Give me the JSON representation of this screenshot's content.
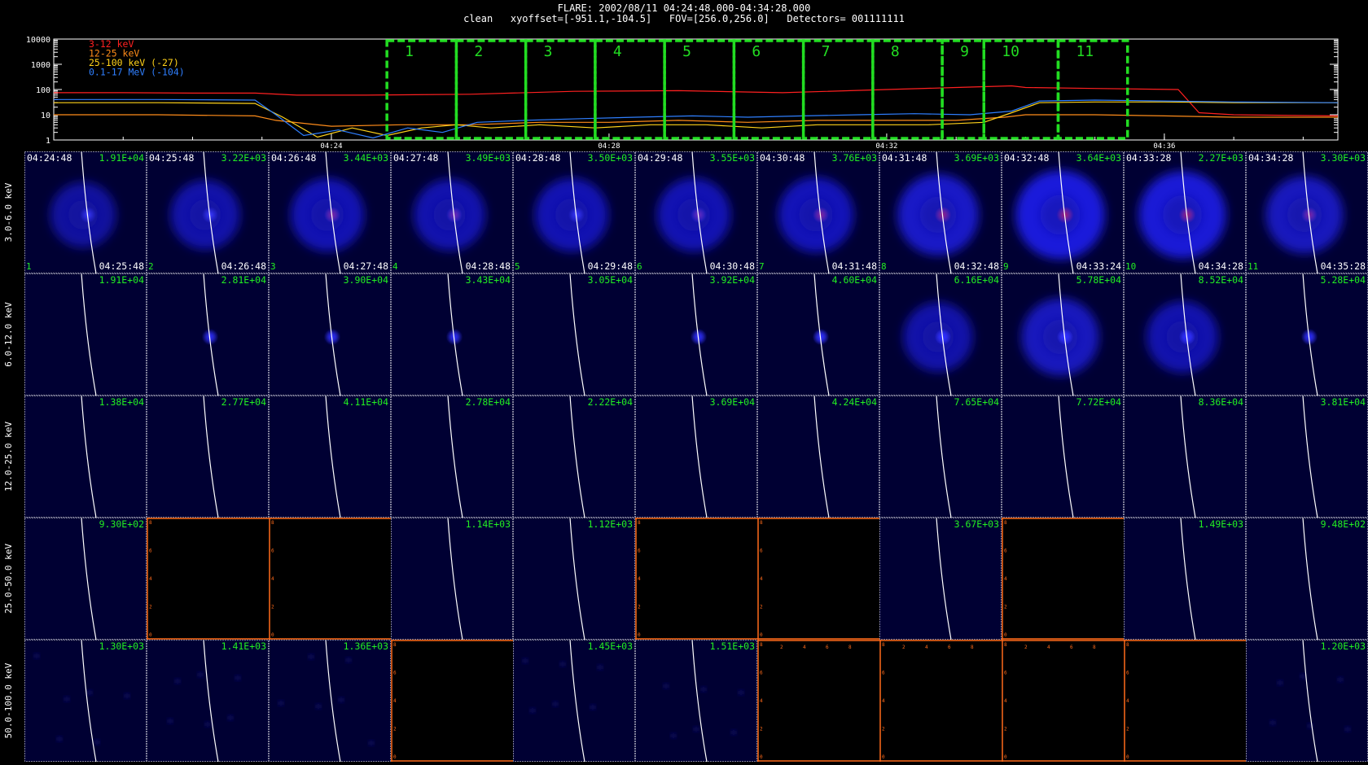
{
  "header": {
    "line1": "FLARE: 2002/08/11 04:24:48.000-04:34:28.000",
    "line2": "clean   xyoffset=[-951.1,-104.5]   FOV=[256.0,256.0]   Detectors= 001111111"
  },
  "lightcurve": {
    "type": "line",
    "y_scale": "log",
    "ylim": [
      1,
      10000
    ],
    "y_ticks": [
      "10000",
      "1000",
      "100",
      "10",
      "1"
    ],
    "x_ticks": [
      {
        "t": 24.0,
        "label": "04:24"
      },
      {
        "t": 28.0,
        "label": "04:28"
      },
      {
        "t": 32.0,
        "label": "04:32"
      },
      {
        "t": 36.0,
        "label": "04:36"
      }
    ],
    "xlim": [
      20.0,
      38.5
    ],
    "legend": [
      {
        "label": "3-12 keV",
        "color": "#ff2020"
      },
      {
        "label": "12-25 keV",
        "color": "#ff8c1a"
      },
      {
        "label": "25-100 keV (-27)",
        "color": "#ffd21a"
      },
      {
        "label": "0.1-17 MeV (-104)",
        "color": "#2f7fff"
      }
    ],
    "series": [
      {
        "name": "3-12 keV",
        "color": "#ff2020",
        "x": [
          20.0,
          21.0,
          22.0,
          22.9,
          23.5,
          24.5,
          26.0,
          27.5,
          29.0,
          30.5,
          32.0,
          33.0,
          33.8,
          34.0,
          35.0,
          36.2,
          36.5,
          37.0,
          38.5
        ],
        "values": [
          75,
          75,
          72,
          72,
          60,
          60,
          65,
          85,
          90,
          75,
          100,
          120,
          140,
          120,
          110,
          100,
          12,
          10,
          9
        ]
      },
      {
        "name": "12-25 keV",
        "color": "#ff8c1a",
        "x": [
          20.0,
          21.5,
          22.9,
          23.2,
          24.0,
          25.0,
          26.0,
          27.0,
          28.0,
          29.0,
          30.0,
          31.0,
          32.0,
          33.0,
          33.7,
          34.0,
          35.0,
          36.0,
          37.0,
          38.5
        ],
        "values": [
          10,
          10,
          9,
          6,
          3.5,
          4,
          4,
          5,
          5,
          6,
          5,
          6,
          6,
          6,
          8,
          10,
          10,
          9,
          8,
          8
        ]
      },
      {
        "name": "25-100 keV (-27)",
        "color": "#ffd21a",
        "x": [
          20.0,
          21.5,
          22.9,
          23.3,
          23.8,
          24.3,
          24.8,
          25.3,
          25.8,
          26.3,
          27.0,
          27.8,
          28.6,
          29.4,
          30.2,
          31.0,
          31.8,
          32.6,
          33.4,
          33.8,
          34.2,
          35.0,
          36.0,
          37.0,
          38.5
        ],
        "values": [
          30,
          30,
          28,
          8,
          1.3,
          3,
          1.5,
          3,
          4,
          3,
          4,
          3,
          4,
          4,
          3,
          4,
          4,
          4,
          5,
          12,
          30,
          32,
          32,
          30,
          30
        ]
      },
      {
        "name": "0.1-17 MeV (-104)",
        "color": "#2f7fff",
        "x": [
          20.0,
          21.5,
          22.9,
          23.2,
          23.6,
          24.1,
          24.6,
          25.1,
          25.6,
          26.1,
          26.8,
          27.6,
          28.4,
          29.2,
          30.0,
          30.8,
          31.6,
          32.4,
          33.2,
          33.8,
          34.2,
          35.0,
          36.0,
          37.0,
          38.5
        ],
        "values": [
          40,
          40,
          38,
          10,
          1.5,
          2.5,
          1.2,
          3,
          2,
          5,
          6,
          7,
          8,
          9,
          8,
          9,
          10,
          11,
          10,
          14,
          35,
          38,
          35,
          32,
          30
        ]
      }
    ],
    "intervals": [
      {
        "label": "1",
        "start": 24.8,
        "end": 25.8
      },
      {
        "label": "2",
        "start": 25.8,
        "end": 26.8
      },
      {
        "label": "3",
        "start": 26.8,
        "end": 27.8
      },
      {
        "label": "4",
        "start": 27.8,
        "end": 28.8
      },
      {
        "label": "5",
        "start": 28.8,
        "end": 29.8
      },
      {
        "label": "6",
        "start": 29.8,
        "end": 30.8
      },
      {
        "label": "7",
        "start": 30.8,
        "end": 31.8
      },
      {
        "label": "8",
        "start": 31.8,
        "end": 32.8
      },
      {
        "label": "9",
        "start": 32.8,
        "end": 33.4
      },
      {
        "label": "10",
        "start": 33.4,
        "end": 34.47
      },
      {
        "label": "11",
        "start": 34.47,
        "end": 35.47
      }
    ]
  },
  "image_grid": {
    "columns": [
      {
        "num": "1",
        "start": "04:24:48",
        "end": "04:25:48"
      },
      {
        "num": "2",
        "start": "04:25:48",
        "end": "04:26:48"
      },
      {
        "num": "3",
        "start": "04:26:48",
        "end": "04:27:48"
      },
      {
        "num": "4",
        "start": "04:27:48",
        "end": "04:28:48"
      },
      {
        "num": "5",
        "start": "04:28:48",
        "end": "04:29:48"
      },
      {
        "num": "6",
        "start": "04:29:48",
        "end": "04:30:48"
      },
      {
        "num": "7",
        "start": "04:30:48",
        "end": "04:31:48"
      },
      {
        "num": "8",
        "start": "04:31:48",
        "end": "04:32:48"
      },
      {
        "num": "9",
        "start": "04:32:48",
        "end": "04:33:24"
      },
      {
        "num": "10",
        "start": "04:33:28",
        "end": "04:34:28"
      },
      {
        "num": "11",
        "start": "04:34:28",
        "end": "04:35:28"
      }
    ],
    "rows": [
      {
        "energy": "3.0-6.0 keV",
        "values": [
          "1.91E+04",
          "3.22E+03",
          "3.44E+03",
          "3.49E+03",
          "3.50E+03",
          "3.55E+03",
          "3.76E+03",
          "3.69E+03",
          "3.64E+03",
          "2.27E+03",
          "3.30E+03"
        ],
        "brightness": [
          0.35,
          0.45,
          0.55,
          0.5,
          0.55,
          0.55,
          0.6,
          0.75,
          0.95,
          0.9,
          0.65
        ],
        "ring": [
          true,
          true,
          true,
          true,
          true,
          true,
          true,
          true,
          true,
          true,
          true
        ],
        "core": [
          0.2,
          0.25,
          0.5,
          0.4,
          0.3,
          0.35,
          0.55,
          0.65,
          0.75,
          0.7,
          0.5
        ],
        "empty": [
          false,
          false,
          false,
          false,
          false,
          false,
          false,
          false,
          false,
          false,
          false
        ]
      },
      {
        "energy": "6.0-12.0 keV",
        "values": [
          "1.91E+04",
          "2.81E+04",
          "3.90E+04",
          "3.43E+04",
          "3.05E+04",
          "3.92E+04",
          "4.60E+04",
          "6.16E+04",
          "5.78E+04",
          "8.52E+04",
          "5.28E+04"
        ],
        "brightness": [
          0,
          0.1,
          0.15,
          0.1,
          0,
          0.2,
          0.3,
          0.45,
          0.65,
          0.5,
          0.2
        ],
        "ring": [
          false,
          false,
          false,
          false,
          false,
          false,
          false,
          true,
          true,
          true,
          false
        ],
        "core": [
          0,
          0.5,
          0.6,
          0.4,
          0,
          0.55,
          0.6,
          0.7,
          0.8,
          0.75,
          0.5
        ],
        "empty": [
          false,
          false,
          false,
          false,
          false,
          false,
          false,
          false,
          false,
          false,
          false
        ]
      },
      {
        "energy": "12.0-25.0 keV",
        "values": [
          "1.38E+04",
          "2.77E+04",
          "4.11E+04",
          "2.78E+04",
          "2.22E+04",
          "3.69E+04",
          "4.24E+04",
          "7.65E+04",
          "7.72E+04",
          "8.36E+04",
          "3.81E+04"
        ],
        "brightness": [
          0,
          0,
          0,
          0,
          0,
          0,
          0,
          0,
          0,
          0,
          0
        ],
        "ring": [
          false,
          false,
          false,
          false,
          false,
          false,
          false,
          false,
          false,
          false,
          false
        ],
        "core": [
          0,
          0,
          0,
          0,
          0,
          0,
          0,
          0,
          0,
          0,
          0
        ],
        "empty": [
          false,
          false,
          false,
          false,
          false,
          false,
          false,
          false,
          false,
          false,
          false
        ]
      },
      {
        "energy": "25.0-50.0 keV",
        "values": [
          "9.30E+02",
          "",
          "",
          "1.14E+03",
          "1.12E+03",
          "",
          "",
          "3.67E+03",
          "",
          "1.49E+03",
          "9.48E+02"
        ],
        "brightness": [
          0,
          0,
          0,
          0,
          0,
          0,
          0,
          0,
          0,
          0,
          0
        ],
        "ring": [
          false,
          false,
          false,
          false,
          false,
          false,
          false,
          false,
          false,
          false,
          false
        ],
        "core": [
          0,
          0,
          0,
          0,
          0,
          0,
          0,
          0,
          0,
          0,
          0
        ],
        "empty": [
          false,
          true,
          true,
          false,
          false,
          true,
          true,
          false,
          true,
          false,
          false
        ]
      },
      {
        "energy": "50.0-100.0 keV",
        "values": [
          "1.30E+03",
          "1.41E+03",
          "1.36E+03",
          "",
          "1.45E+03",
          "1.51E+03",
          "",
          "",
          "",
          "",
          "1.20E+03"
        ],
        "brightness": [
          0,
          0,
          0,
          0,
          0,
          0,
          0,
          0,
          0,
          0,
          0
        ],
        "ring": [
          false,
          false,
          false,
          false,
          false,
          false,
          false,
          false,
          false,
          false,
          false
        ],
        "core": [
          0,
          0,
          0,
          0,
          0,
          0,
          0,
          0,
          0,
          0,
          0
        ],
        "empty": [
          false,
          false,
          false,
          true,
          false,
          false,
          true,
          true,
          true,
          true,
          false
        ]
      }
    ],
    "empty_axis_ticks_y": [
      "0",
      "2",
      "4",
      "6",
      "8"
    ],
    "empty_axis_ticks_x": [
      "2",
      "4",
      "6",
      "8"
    ]
  },
  "colors": {
    "background": "#000000",
    "image_bg": "#000033",
    "disk": "#2020ff",
    "core": "#c01040",
    "interval_box": "#22dd22",
    "label_green": "#22ee22",
    "empty_axis": "#ff6a1a",
    "limb": "#ffffff"
  }
}
